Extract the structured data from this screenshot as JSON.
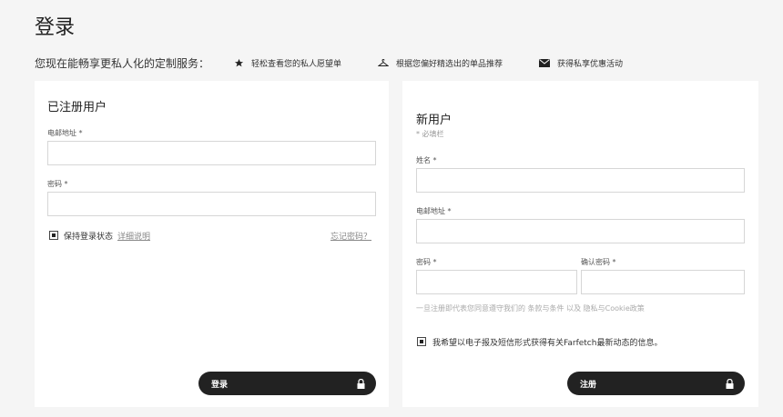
{
  "page": {
    "title": "登录"
  },
  "intro": {
    "text": "您现在能畅享更私人化的定制服务：",
    "benefits": [
      {
        "icon": "star-icon",
        "label": "轻松查看您的私人愿望单"
      },
      {
        "icon": "hanger-icon",
        "label": "根据您偏好精选出的单品推荐"
      },
      {
        "icon": "envelope-icon",
        "label": "获得私享优惠活动"
      }
    ]
  },
  "login": {
    "title": "已注册用户",
    "email_label": "电邮地址 *",
    "email_value": "",
    "password_label": "密码 *",
    "password_value": "",
    "keep_signed_in": "保持登录状态",
    "details_link": "详细说明",
    "forgot_link": "忘记密码？",
    "submit": "登录"
  },
  "register": {
    "title": "新用户",
    "required_note": "* 必填栏",
    "name_label": "姓名 *",
    "name_value": "",
    "email_label": "电邮地址 *",
    "email_value": "",
    "password_label": "密码 *",
    "password_value": "",
    "confirm_label": "确认密码 *",
    "confirm_value": "",
    "terms": "一旦注册即代表您同意遵守我们的 条款与条件 以及 隐私与Cookie政策",
    "optin": "我希望以电子报及短信形式获得有关Farfetch最新动态的信息。",
    "submit": "注册"
  }
}
